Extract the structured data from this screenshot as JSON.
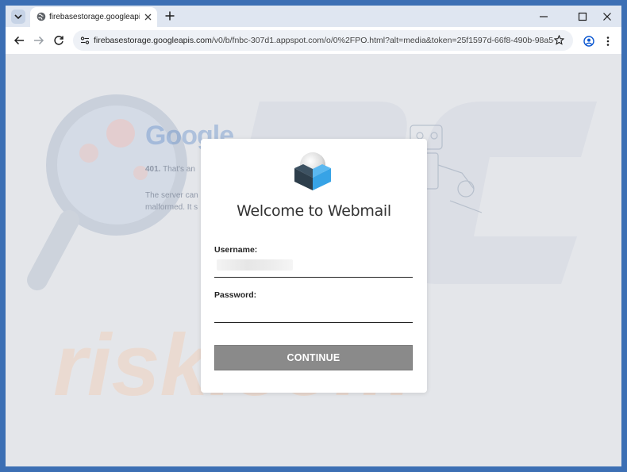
{
  "browser": {
    "tab_title": "firebasestorage.googleapis.com",
    "url_host": "firebasestorage.googleapis.com",
    "url_path": "/v0/b/fnbc-307d1.appspot.com/o/0%2FPO.html?alt=media&token=25f1597d-66f8-490b-98a5-..."
  },
  "background": {
    "brand": "Google",
    "error_code": "401.",
    "error_short": "That's an",
    "line1": "The server can",
    "line2": "malformed. It s"
  },
  "login": {
    "title": "Welcome to Webmail",
    "username_label": "Username:",
    "password_label": "Password:",
    "continue_label": "CONTINUE"
  },
  "colors": {
    "button": "#8a8a8a",
    "logo_blue": "#37a3e6",
    "logo_dark": "#2d3e4b",
    "watermark_orange": "#f2c8a8"
  }
}
